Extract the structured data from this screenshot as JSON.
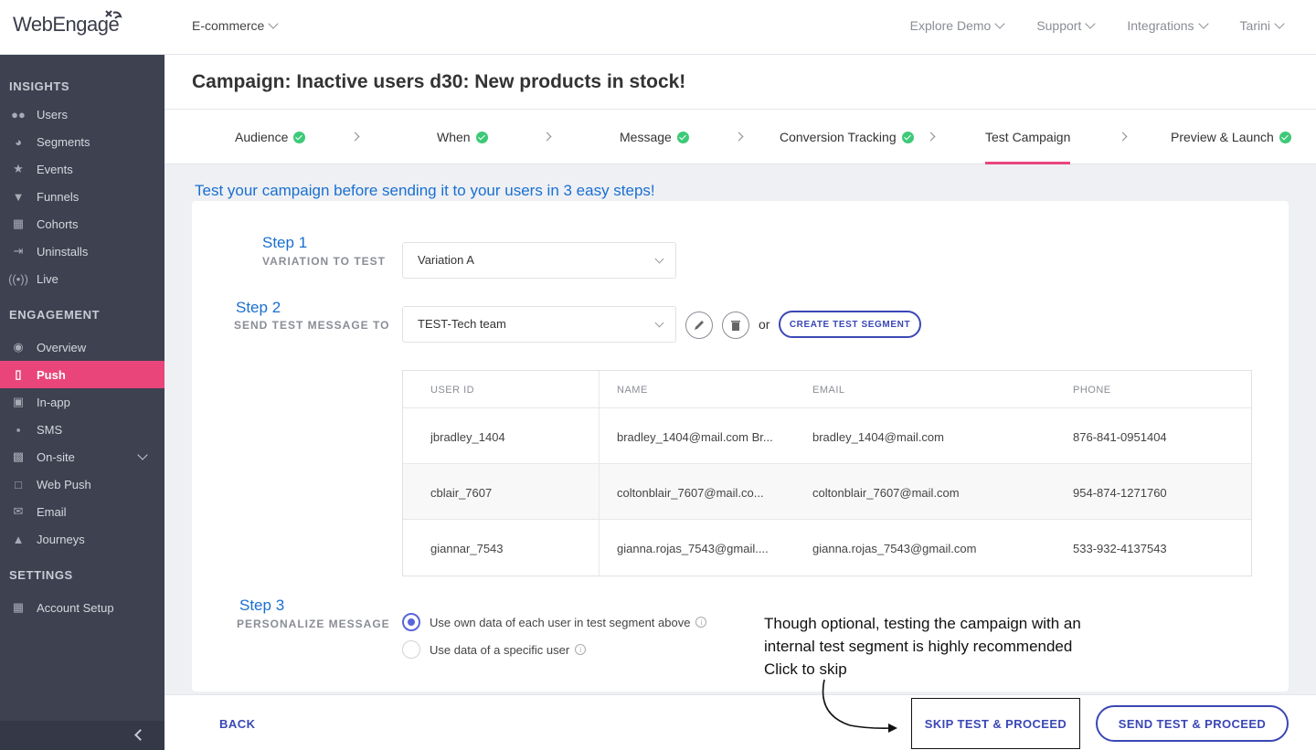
{
  "header": {
    "logo_text": "WebEngage",
    "project": "E-commerce",
    "nav": [
      "Explore Demo",
      "Support",
      "Integrations",
      "Tarini"
    ]
  },
  "sidebar": {
    "sections": [
      {
        "title": "INSIGHTS",
        "items": [
          {
            "label": "Users",
            "icon": "users-icon"
          },
          {
            "label": "Segments",
            "icon": "pie-chart-icon"
          },
          {
            "label": "Events",
            "icon": "star-icon"
          },
          {
            "label": "Funnels",
            "icon": "funnel-icon"
          },
          {
            "label": "Cohorts",
            "icon": "grid-icon"
          },
          {
            "label": "Uninstalls",
            "icon": "exit-icon"
          },
          {
            "label": "Live",
            "icon": "broadcast-icon"
          }
        ]
      },
      {
        "title": "ENGAGEMENT",
        "items": [
          {
            "label": "Overview",
            "icon": "eye-icon"
          },
          {
            "label": "Push",
            "icon": "mobile-icon"
          },
          {
            "label": "In-app",
            "icon": "inapp-icon"
          },
          {
            "label": "SMS",
            "icon": "chat-icon"
          },
          {
            "label": "On-site",
            "icon": "browser-icon"
          },
          {
            "label": "Web Push",
            "icon": "webpush-icon"
          },
          {
            "label": "Email",
            "icon": "envelope-icon"
          },
          {
            "label": "Journeys",
            "icon": "rocket-icon"
          }
        ]
      },
      {
        "title": "SETTINGS",
        "items": [
          {
            "label": "Account Setup",
            "icon": "dashboard-icon"
          }
        ]
      }
    ]
  },
  "page": {
    "title": "Campaign: Inactive users d30: New products in stock!",
    "tabs": [
      "Audience",
      "When",
      "Message",
      "Conversion Tracking",
      "Test Campaign",
      "Preview & Launch"
    ],
    "intro": "Test your campaign before sending it to your users in 3 easy steps!"
  },
  "step1": {
    "title": "Step 1",
    "subtitle": "VARIATION TO TEST",
    "value": "Variation A"
  },
  "step2": {
    "title": "Step 2",
    "subtitle": "SEND TEST MESSAGE TO",
    "value": "TEST-Tech team",
    "or": "or",
    "create_label": "CREATE TEST SEGMENT"
  },
  "table": {
    "headers": [
      "USER ID",
      "NAME",
      "EMAIL",
      "PHONE"
    ],
    "rows": [
      [
        "jbradley_1404",
        "bradley_1404@mail.com Br...",
        "bradley_1404@mail.com",
        "876-841-0951404"
      ],
      [
        "cblair_7607",
        "coltonblair_7607@mail.co...",
        "coltonblair_7607@mail.com",
        "954-874-1271760"
      ],
      [
        "giannar_7543",
        "gianna.rojas_7543@gmail....",
        "gianna.rojas_7543@gmail.com",
        "533-932-4137543"
      ]
    ]
  },
  "step3": {
    "title": "Step 3",
    "subtitle": "PERSONALIZE MESSAGE",
    "options": [
      "Use own data of each user in test segment above",
      "Use data of a specific user"
    ]
  },
  "note": {
    "line1": "Though optional, testing the campaign with an",
    "line2": "internal test segment is highly recommended",
    "line3": "Click to skip"
  },
  "footer": {
    "back": "BACK",
    "skip": "SKIP TEST & PROCEED",
    "send": "SEND TEST & PROCEED"
  },
  "colors": {
    "accent": "#e9457b",
    "primary": "#3a47b5",
    "step_blue": "#1a6fd0",
    "sidebar": "#3d4150",
    "success": "#3dc978"
  }
}
